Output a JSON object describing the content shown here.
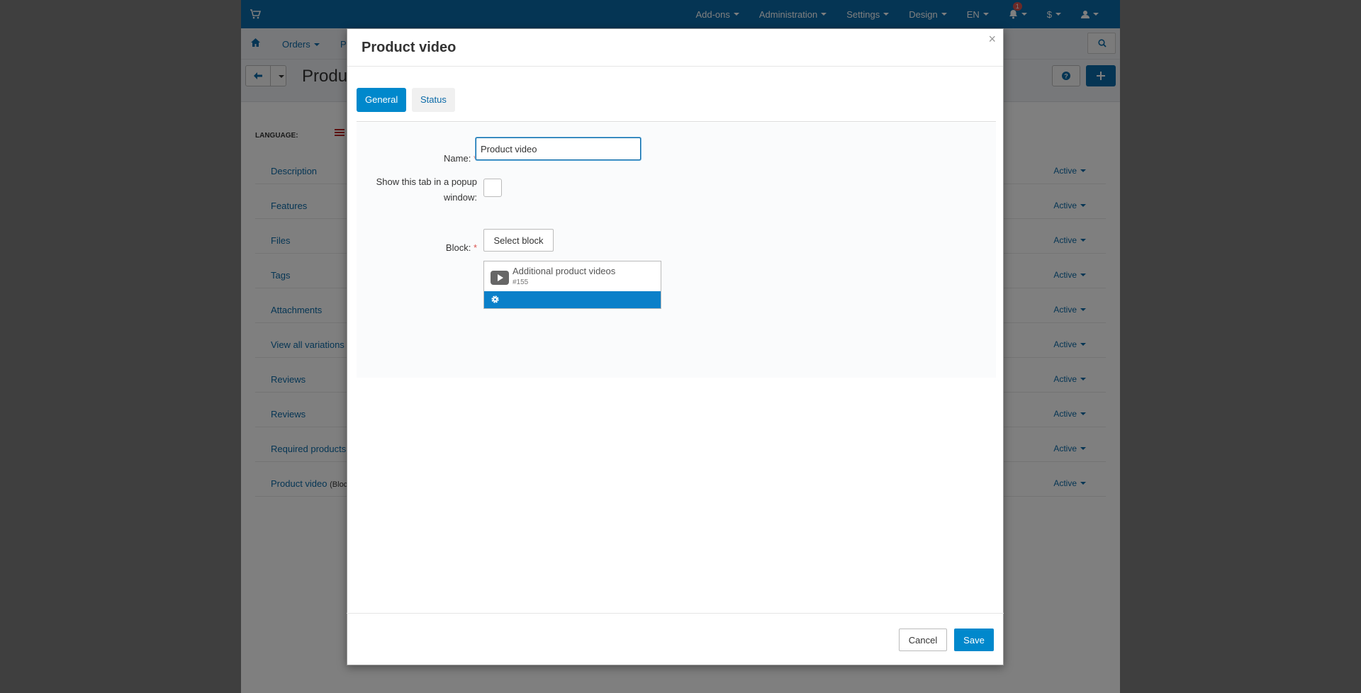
{
  "topbar": {
    "items": [
      {
        "label": "Add-ons"
      },
      {
        "label": "Administration"
      },
      {
        "label": "Settings"
      },
      {
        "label": "Design"
      },
      {
        "label": "EN"
      }
    ],
    "notification_count": "1",
    "currency": "$"
  },
  "subnav": {
    "orders_label": "Orders",
    "products_label": "P"
  },
  "toolbar": {
    "title": "Produ"
  },
  "background": {
    "language_label": "LANGUAGE:",
    "rows": [
      {
        "name": "Description",
        "status": "Active"
      },
      {
        "name": "Features",
        "status": "Active"
      },
      {
        "name": "Files",
        "status": "Active"
      },
      {
        "name": "Tags",
        "status": "Active"
      },
      {
        "name": "Attachments",
        "status": "Active"
      },
      {
        "name": "View all variations",
        "status": "Active"
      },
      {
        "name": "Reviews",
        "status": "Active"
      },
      {
        "name": "Reviews",
        "status": "Active"
      },
      {
        "name": "Required products",
        "status": "Active"
      },
      {
        "name": "Product video",
        "suffix": "(Bloc",
        "status": "Active"
      }
    ]
  },
  "modal": {
    "title": "Product video",
    "close_glyph": "×",
    "tabs": [
      {
        "label": "General"
      },
      {
        "label": "Status"
      }
    ],
    "form": {
      "name_label": "Name:",
      "name_value": "Product video",
      "popup_label": "Show this tab in a popup window:",
      "block_label": "Block:",
      "required_mark": "*",
      "select_block_label": "Select block"
    },
    "block": {
      "name": "Additional product videos",
      "id": "#155"
    },
    "footer": {
      "cancel_label": "Cancel",
      "save_label": "Save"
    }
  },
  "colors": {
    "accent": "#0088cc",
    "topbar": "#0b6aa8",
    "required": "#d9534f"
  }
}
